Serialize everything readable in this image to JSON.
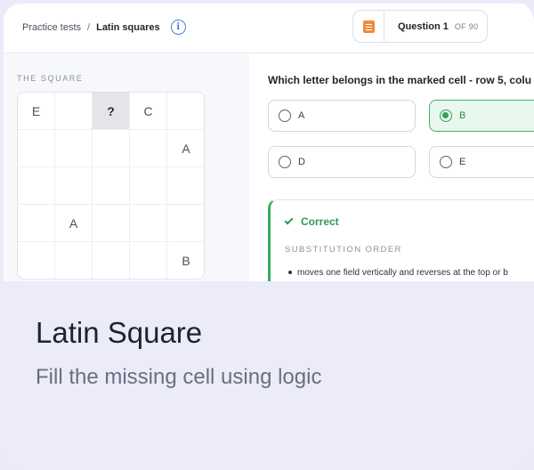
{
  "breadcrumb": {
    "parent": "Practice tests",
    "separator": "/",
    "current": "Latin squares"
  },
  "question_nav": {
    "label": "Question 1",
    "of": "OF 90"
  },
  "square": {
    "title": "THE SQUARE",
    "cells": [
      "E",
      "",
      "?",
      "C",
      "",
      "",
      "",
      "",
      "",
      "A",
      "",
      "",
      "",
      "",
      "",
      "",
      "A",
      "",
      "",
      "",
      "",
      "",
      "",
      "",
      "B"
    ],
    "marked_index": 2
  },
  "question": {
    "text": "Which letter belongs in the marked cell - row 5, colu"
  },
  "options": [
    {
      "label": "A",
      "selected": false
    },
    {
      "label": "B",
      "selected": true
    },
    {
      "label": "D",
      "selected": false
    },
    {
      "label": "E",
      "selected": false
    }
  ],
  "feedback": {
    "status": "Correct",
    "section": "SUBSTITUTION ORDER",
    "item": "moves one field vertically and reverses at the top or b"
  },
  "caption": {
    "title": "Latin Square",
    "subtitle": "Fill the missing cell using logic"
  },
  "colors": {
    "accent_green": "#3bab62",
    "accent_orange": "#f08a3c",
    "info_blue": "#4a7fd6"
  }
}
